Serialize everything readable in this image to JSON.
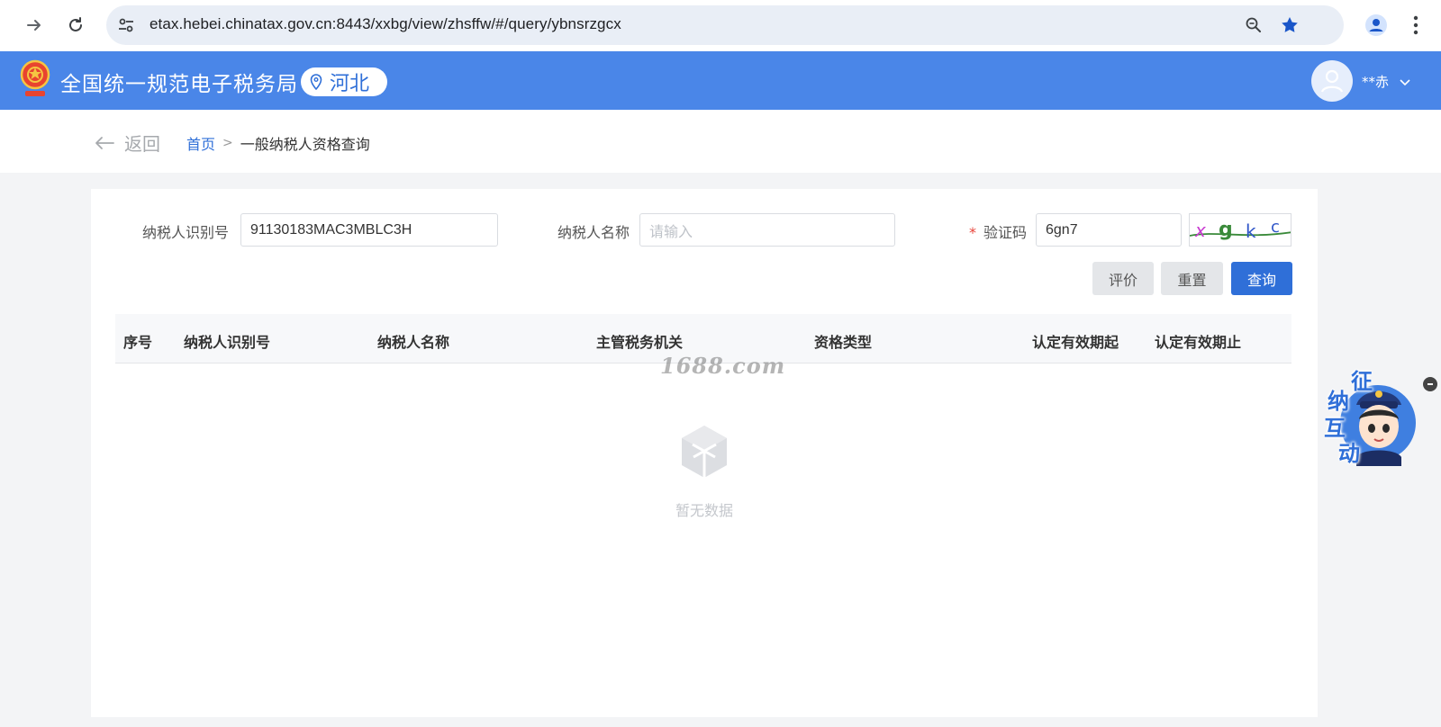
{
  "browser": {
    "url": "etax.hebei.chinatax.gov.cn:8443/xxbg/view/zhsffw/#/query/ybnsrzgcx"
  },
  "header": {
    "title": "全国统一规范电子税务局",
    "region": "河北",
    "user_name": "**赤"
  },
  "breadcrumb": {
    "back_label": "返回",
    "home": "首页",
    "separator": ">",
    "current": "一般纳税人资格查询"
  },
  "form": {
    "taxpayer_id_label": "纳税人识别号",
    "taxpayer_id_value": "91130183MAC3MBLC3H",
    "taxpayer_name_label": "纳税人名称",
    "taxpayer_name_placeholder": "请输入",
    "captcha_required_mark": "*",
    "captcha_label": "验证码",
    "captcha_value": "6gn7",
    "captcha_image_text": "xgkc"
  },
  "actions": {
    "evaluate": "评价",
    "reset": "重置",
    "query": "查询"
  },
  "table": {
    "columns": [
      "序号",
      "纳税人识别号",
      "纳税人名称",
      "主管税务机关",
      "资格类型",
      "认定有效期起",
      "认定有效期止"
    ],
    "empty_text": "暂无数据"
  },
  "watermark": "1688.com",
  "assistant": {
    "chars": [
      "征",
      "纳",
      "互",
      "动"
    ]
  },
  "colors": {
    "header_blue": "#4a86e8",
    "primary_blue": "#2f6fd8",
    "page_bg": "#f3f4f6"
  }
}
